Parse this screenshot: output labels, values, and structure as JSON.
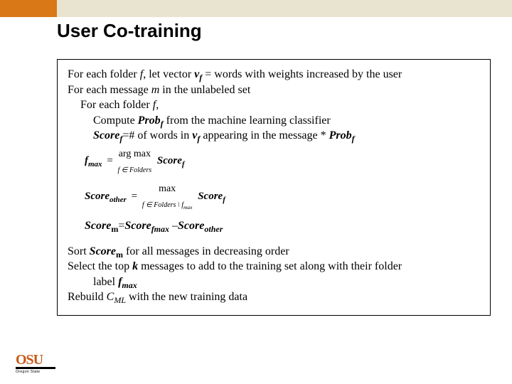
{
  "slide": {
    "title": "User Co-training",
    "lines": {
      "l1_pre": "For each folder ",
      "l1_f": "f",
      "l1_mid": ", let vector ",
      "l1_vf": "v",
      "l1_vf_sub": "f",
      "l1_post": " = words with weights increased by the user",
      "l2_pre": "For each message ",
      "l2_m": "m",
      "l2_post": " in the unlabeled set",
      "l3_pre": "For each folder ",
      "l3_f": "f",
      "l3_post": ",",
      "l4_pre": "Compute ",
      "l4_prob": "Prob",
      "l4_prob_sub": "f",
      "l4_post": "  from the machine learning classifier",
      "l5_score": "Score",
      "l5_score_sub": "f",
      "l5_eq": "=# of words in ",
      "l5_vf": "v",
      "l5_vf_sub": "f",
      "l5_mid": " appearing in the message *  ",
      "l5_prob": "Prob",
      "l5_prob_sub": "f",
      "eq1_lhs": "f",
      "eq1_lhs_sub": "max",
      "eq1_rhs": "arg max",
      "eq1_under": "f ∈ Folders",
      "eq1_tail": "Score",
      "eq1_tail_sub": "f",
      "eq2_lhs": "Score",
      "eq2_lhs_sub": "other",
      "eq2_max": "max",
      "eq2_under": "f ∈ Folders \\ f",
      "eq2_under_sub": "max",
      "eq2_tail": "Score",
      "eq2_tail_sub": "f",
      "score_line": "Score",
      "score_sub_m": "m",
      "score_eq": "=",
      "score_fmax": "Score",
      "score_fmax_sub": "fmax",
      "score_minus": " –",
      "score_other": "Score",
      "score_other_sub": "other",
      "l6_pre": "Sort ",
      "l6_score": "Score",
      "l6_score_sub": "m",
      "l6_post": " for all messages in decreasing order",
      "l7_pre": "Select the top ",
      "l7_k": "k",
      "l7_post": " messages to add to the training set along with their folder",
      "l7b_pre": "label ",
      "l7b_f": "f",
      "l7b_sub": "max",
      "l8_pre": "Rebuild ",
      "l8_c": "C",
      "l8_c_sub": "ML",
      "l8_post": " with the new training data"
    }
  },
  "logo": {
    "main": "OSU",
    "sub": "Oregon State"
  }
}
